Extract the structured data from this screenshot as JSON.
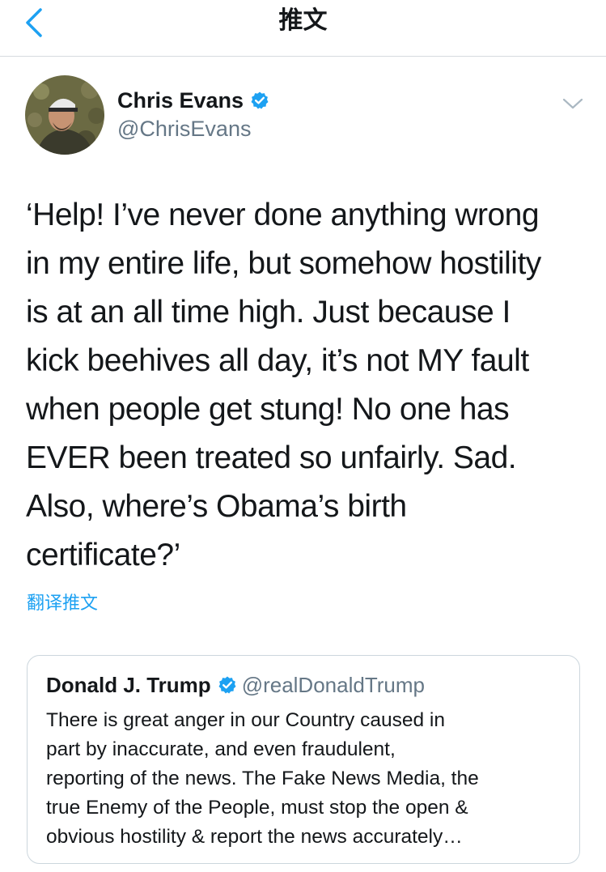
{
  "navbar": {
    "title": "推文",
    "back_icon": "chevron-left-icon"
  },
  "tweet": {
    "author_name": "Chris Evans",
    "author_handle": "@ChrisEvans",
    "verified_icon": "verified-badge-icon",
    "menu_icon": "chevron-down-icon",
    "text": "‘Help! I’ve never done anything wrong\nin my entire life, but somehow hostility\nis at an all time high. Just because I\nkick beehives all day, it’s not MY fault\nwhen people get stung! No one has\nEVER been treated so unfairly. Sad.\nAlso, where’s Obama’s birth\ncertificate?’",
    "translate_label": "翻译推文"
  },
  "quoted_tweet": {
    "author_name": "Donald J. Trump",
    "author_handle": "@realDonaldTrump",
    "text": "There is great anger in our Country caused in\npart by inaccurate, and even fraudulent,\nreporting of the news. The Fake News Media, the\ntrue Enemy of the People, must stop the open &\nobvious hostility & report the news accurately…"
  },
  "colors": {
    "accent": "#1da1f2",
    "text": "#14171a",
    "secondary": "#657786",
    "border": "#ccd6dd"
  }
}
